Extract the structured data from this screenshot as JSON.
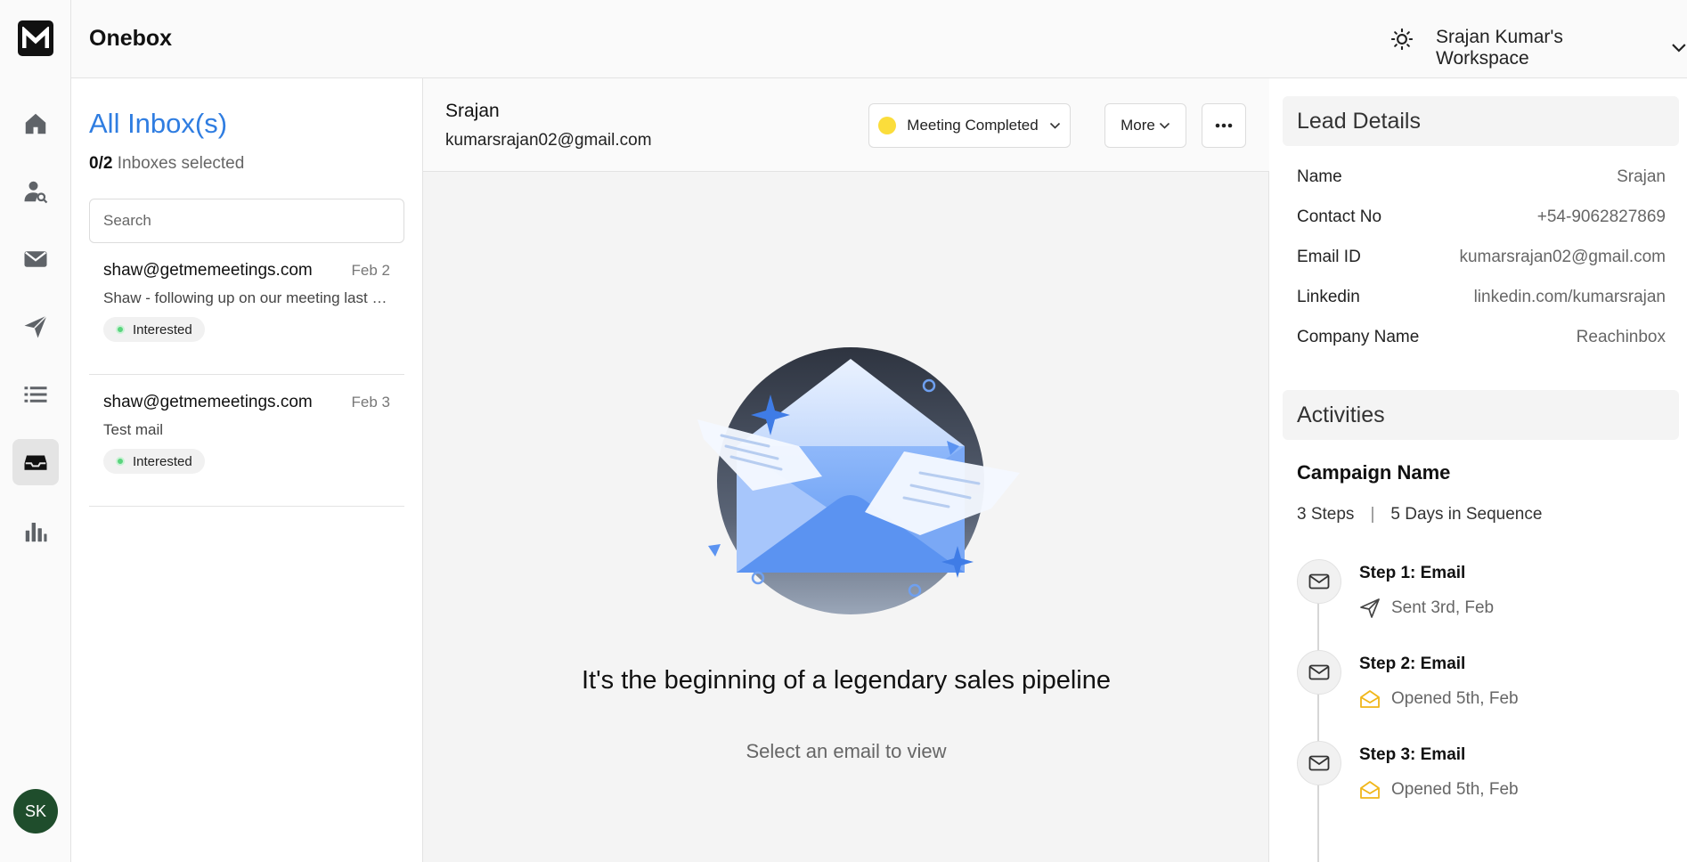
{
  "app": {
    "title": "Onebox",
    "workspace": "Srajan Kumar's Workspace",
    "user_initials": "SK"
  },
  "nav": {
    "items": [
      {
        "name": "home-icon"
      },
      {
        "name": "user-search-icon"
      },
      {
        "name": "mail-icon"
      },
      {
        "name": "send-icon"
      },
      {
        "name": "list-icon"
      },
      {
        "name": "inbox-icon"
      },
      {
        "name": "bar-chart-icon"
      }
    ],
    "active": "inbox-icon"
  },
  "inbox": {
    "title": "All Inbox(s)",
    "selected_count": "0/2",
    "selected_label": "Inboxes selected",
    "search_placeholder": "Search",
    "mails": [
      {
        "from": "shaw@getmemeetings.com",
        "date": "Feb 2",
        "subject": "Shaw - following up on our meeting last week",
        "tag": "Interested"
      },
      {
        "from": "shaw@getmemeetings.com",
        "date": "Feb 3",
        "subject": "Test mail",
        "tag": "Interested"
      }
    ]
  },
  "thread": {
    "lead_name": "Srajan",
    "lead_email": "kumarsrajan02@gmail.com",
    "status": "Meeting Completed",
    "more_label": "More",
    "empty_title": "It's the beginning of a legendary sales pipeline",
    "empty_subtitle": "Select an email to view"
  },
  "lead_details": {
    "heading": "Lead Details",
    "rows": [
      {
        "key": "Name",
        "value": "Srajan"
      },
      {
        "key": "Contact No",
        "value": "+54-9062827869"
      },
      {
        "key": "Email ID",
        "value": "kumarsrajan02@gmail.com"
      },
      {
        "key": "Linkedin",
        "value": "linkedin.com/kumarsrajan"
      },
      {
        "key": "Company Name",
        "value": "Reachinbox"
      }
    ]
  },
  "activities": {
    "heading": "Activities",
    "campaign_name": "Campaign Name",
    "steps_count": "3 Steps",
    "sequence": "5 Days in Sequence",
    "steps": [
      {
        "title": "Step 1: Email",
        "status": "Sent 3rd, Feb",
        "status_icon": "send-icon"
      },
      {
        "title": "Step 2: Email",
        "status": "Opened 5th, Feb",
        "status_icon": "open-mail-icon"
      },
      {
        "title": "Step 3: Email",
        "status": "Opened 5th, Feb",
        "status_icon": "open-mail-icon"
      }
    ]
  },
  "colors": {
    "accent": "#2f7de1",
    "status_dot": "#fbdd3b",
    "interested_dot": "#5ad47d",
    "opened_icon": "#f0b619",
    "avatar": "#1f4d2c"
  }
}
